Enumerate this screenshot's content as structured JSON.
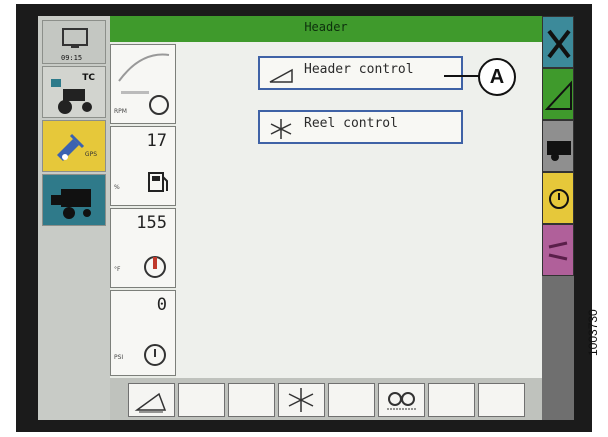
{
  "header": {
    "title": "Header"
  },
  "left_strip": {
    "time": "09:15",
    "tc_label": "TC",
    "gps_label": "GPS"
  },
  "gauges": [
    {
      "value": "",
      "unit": "RPM"
    },
    {
      "value": "17",
      "unit": "%"
    },
    {
      "value": "155",
      "unit": "°F"
    },
    {
      "value": "0",
      "unit": "PSI"
    }
  ],
  "main": {
    "buttons": [
      {
        "label": "Header control"
      },
      {
        "label": "Reel control"
      }
    ]
  },
  "callout": {
    "label": "A"
  },
  "figure": {
    "number": "1003730"
  },
  "colors": {
    "header_bar": "#3f9a2c",
    "button_border": "#3f62a6"
  }
}
